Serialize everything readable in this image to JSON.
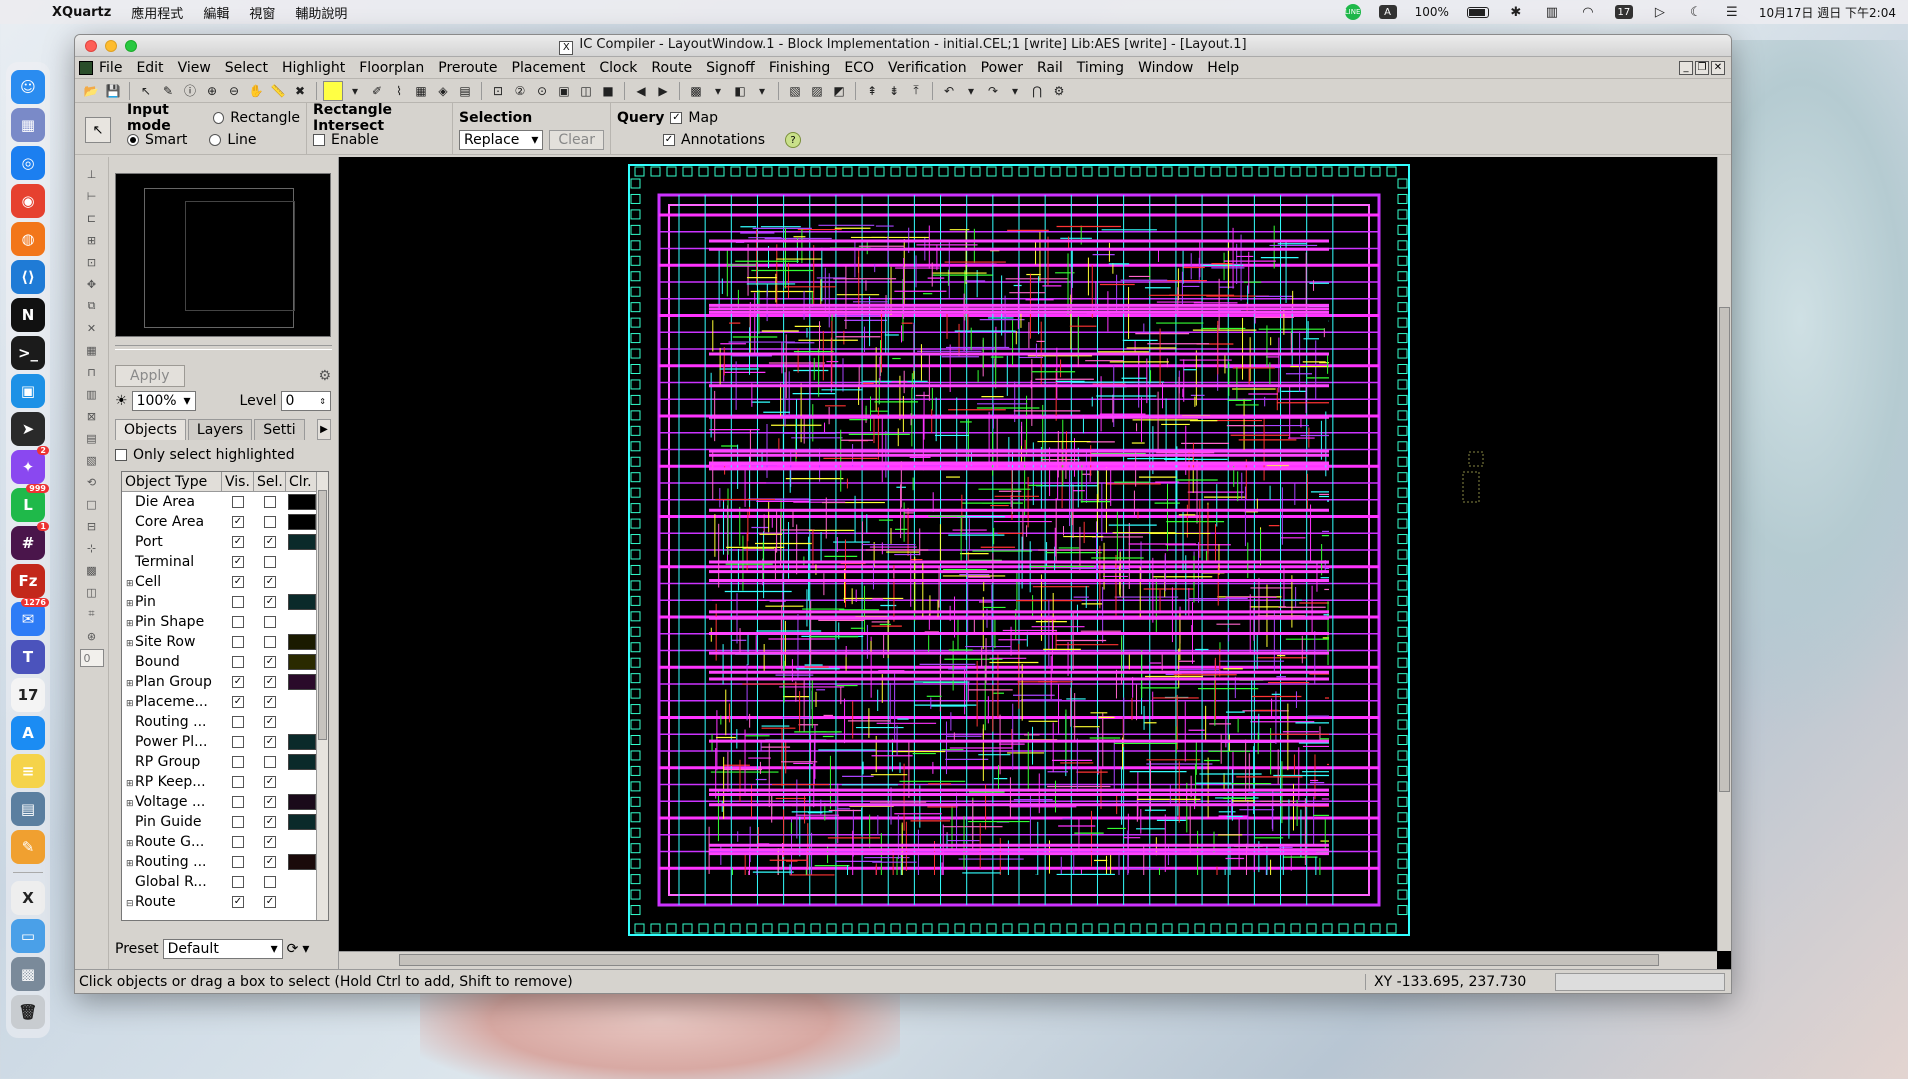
{
  "menubar": {
    "app": "XQuartz",
    "items": [
      "應用程式",
      "編輯",
      "視窗",
      "輔助說明"
    ],
    "battery": "100%",
    "calendar_day": "17",
    "clock": "10月17日 週日 下午2:04",
    "line_label": "LINE",
    "a_label": "A"
  },
  "dock": {
    "apps": [
      {
        "icon": "finder-icon",
        "color": "#2a8cf0",
        "glyph": "☺"
      },
      {
        "icon": "launchpad-icon",
        "color": "#7a8ac8",
        "glyph": "▦"
      },
      {
        "icon": "safari-icon",
        "color": "#1c7ff0",
        "glyph": "◎"
      },
      {
        "icon": "chrome-icon",
        "color": "#e6412f",
        "glyph": "◉"
      },
      {
        "icon": "firefox-icon",
        "color": "#f2761a",
        "glyph": "◍"
      },
      {
        "icon": "vscode-icon",
        "color": "#1f7bd6",
        "glyph": "⟨⟩"
      },
      {
        "icon": "notion-icon",
        "color": "#111111",
        "glyph": "N"
      },
      {
        "icon": "terminal-icon",
        "color": "#1b1b1b",
        "glyph": ">_"
      },
      {
        "icon": "docker-icon",
        "color": "#1d91e6",
        "glyph": "▣"
      },
      {
        "icon": "telegram-icon",
        "color": "#2a2a2a",
        "glyph": "➤"
      },
      {
        "icon": "messenger-icon",
        "color": "#8a48f0",
        "glyph": "✦",
        "badge": "2"
      },
      {
        "icon": "line-icon",
        "color": "#1fb94a",
        "glyph": "L",
        "badge": "999"
      },
      {
        "icon": "slack-icon",
        "color": "#4a154b",
        "glyph": "#",
        "badge": "1"
      },
      {
        "icon": "filezilla-icon",
        "color": "#c3281b",
        "glyph": "Fz"
      },
      {
        "icon": "mail-icon",
        "color": "#2e7cf6",
        "glyph": "✉",
        "badge": "1276"
      },
      {
        "icon": "teams-icon",
        "color": "#4b53bc",
        "glyph": "T"
      },
      {
        "icon": "calendar-icon",
        "color": "#f4f4f4",
        "glyph": "17"
      },
      {
        "icon": "app-store-icon",
        "color": "#1b8cf3",
        "glyph": "A"
      },
      {
        "icon": "notes-icon",
        "color": "#f5d34a",
        "glyph": "≡"
      },
      {
        "icon": "preview-icon",
        "color": "#5b7fa0",
        "glyph": "▤"
      },
      {
        "icon": "pencil-icon",
        "color": "#f0a030",
        "glyph": "✎"
      },
      {
        "icon": "x11-icon",
        "color": "#eeeeee",
        "glyph": "X"
      },
      {
        "icon": "folder-icon",
        "color": "#4aa0e8",
        "glyph": "▭"
      },
      {
        "icon": "screenshot-icon",
        "color": "#7a8a9a",
        "glyph": "▩"
      },
      {
        "icon": "trash-icon",
        "color": "#c8ccd0",
        "glyph": "🗑"
      }
    ]
  },
  "window": {
    "title": "IC Compiler - LayoutWindow.1 - Block Implementation - initial.CEL;1 [write]  Lib:AES [write] - [Layout.1]",
    "menus": [
      "File",
      "Edit",
      "View",
      "Select",
      "Highlight",
      "Floorplan",
      "Preroute",
      "Placement",
      "Clock",
      "Route",
      "Signoff",
      "Finishing",
      "ECO",
      "Verification",
      "Power",
      "Rail",
      "Timing",
      "Window",
      "Help"
    ]
  },
  "options": {
    "input_mode_label": "Input mode",
    "rectangle": "Rectangle",
    "smart": "Smart",
    "line": "Line",
    "rect_intersect_label": "Rectangle Intersect",
    "enable": "Enable",
    "selection_label": "Selection",
    "selection_value": "Replace",
    "clear": "Clear",
    "query_label": "Query",
    "map": "Map",
    "annotations": "Annotations"
  },
  "panel": {
    "apply": "Apply",
    "zoom": "100%",
    "level_label": "Level",
    "level_value": "0",
    "tabs": [
      "Objects",
      "Layers",
      "Setti"
    ],
    "only_select_highlighted": "Only select highlighted",
    "columns": [
      "Object Type",
      "Vis.",
      "Sel.",
      "Clr."
    ],
    "rows": [
      {
        "name": "Die Area",
        "exp": "",
        "vis": false,
        "sel": false,
        "clr": "#000000"
      },
      {
        "name": "Core Area",
        "exp": "",
        "vis": true,
        "sel": false,
        "clr": "#000000"
      },
      {
        "name": "Port",
        "exp": "",
        "vis": true,
        "sel": true,
        "clr": "#0a2a2a"
      },
      {
        "name": "Terminal",
        "exp": "",
        "vis": true,
        "sel": false,
        "clr": ""
      },
      {
        "name": "Cell",
        "exp": "+",
        "vis": true,
        "sel": true,
        "clr": ""
      },
      {
        "name": "Pin",
        "exp": "+",
        "vis": false,
        "sel": true,
        "clr": "#0a2a2a"
      },
      {
        "name": "Pin Shape",
        "exp": "+",
        "vis": false,
        "sel": false,
        "clr": ""
      },
      {
        "name": "Site Row",
        "exp": "+",
        "vis": false,
        "sel": false,
        "clr": "#1a1a00"
      },
      {
        "name": "Bound",
        "exp": "",
        "vis": false,
        "sel": true,
        "clr": "#2a2a00"
      },
      {
        "name": "Plan Group",
        "exp": "+",
        "vis": true,
        "sel": true,
        "clr": "#2a0a2a"
      },
      {
        "name": "Placeme...",
        "exp": "+",
        "vis": true,
        "sel": true,
        "clr": ""
      },
      {
        "name": "Routing ...",
        "exp": "",
        "vis": false,
        "sel": true,
        "clr": ""
      },
      {
        "name": "Power Pl...",
        "exp": "",
        "vis": false,
        "sel": true,
        "clr": "#0a2a2a"
      },
      {
        "name": "RP Group",
        "exp": "",
        "vis": false,
        "sel": false,
        "clr": "#0a2a2a"
      },
      {
        "name": "RP Keep...",
        "exp": "+",
        "vis": false,
        "sel": true,
        "clr": ""
      },
      {
        "name": "Voltage ...",
        "exp": "+",
        "vis": false,
        "sel": true,
        "clr": "#1a0a1a"
      },
      {
        "name": "Pin Guide",
        "exp": "",
        "vis": false,
        "sel": true,
        "clr": "#0a2a2a"
      },
      {
        "name": "Route G...",
        "exp": "+",
        "vis": false,
        "sel": true,
        "clr": ""
      },
      {
        "name": "Routing ...",
        "exp": "+",
        "vis": false,
        "sel": true,
        "clr": "#1a0a0a"
      },
      {
        "name": "Global R...",
        "exp": "",
        "vis": false,
        "sel": false,
        "clr": ""
      },
      {
        "name": "Route",
        "exp": "-",
        "vis": true,
        "sel": true,
        "clr": ""
      }
    ],
    "preset_label": "Preset",
    "preset_value": "Default"
  },
  "status": {
    "message": "Click objects or drag a box to select (Hold Ctrl to add, Shift to remove)",
    "xy": "XY -133.695, 237.730"
  },
  "colors": {
    "canvas": "#000000",
    "route_colors": [
      "#ff33ff",
      "#33ff33",
      "#ff3333",
      "#ffff33",
      "#33ffff",
      "#aa44ff",
      "#ff66cc"
    ]
  }
}
